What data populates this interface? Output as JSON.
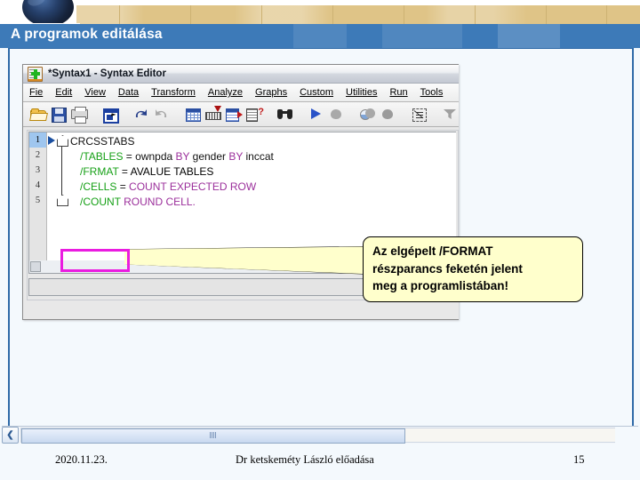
{
  "slide": {
    "title": "A programok editálása"
  },
  "spss_window": {
    "title": "*Syntax1 - Syntax Editor",
    "icon": "spss-document-icon",
    "menus": [
      {
        "label": "Fie",
        "accel": "F"
      },
      {
        "label": "Edit",
        "accel": "d"
      },
      {
        "label": "View",
        "accel": "V"
      },
      {
        "label": "Data",
        "accel": "D"
      },
      {
        "label": "Transform",
        "accel": "T"
      },
      {
        "label": "Analyze",
        "accel": "A"
      },
      {
        "label": "Graphs",
        "accel": "G"
      },
      {
        "label": "Custom",
        "accel": "C"
      },
      {
        "label": "Utilities",
        "accel": "U"
      },
      {
        "label": "Run",
        "accel": "R"
      },
      {
        "label": "Tools",
        "accel": "s"
      }
    ],
    "toolbar": [
      {
        "name": "open-file-icon"
      },
      {
        "name": "save-file-icon"
      },
      {
        "name": "print-icon"
      },
      {
        "name": "recall-dialog-icon"
      },
      {
        "name": "undo-icon"
      },
      {
        "name": "redo-icon"
      },
      {
        "name": "goto-data-icon"
      },
      {
        "name": "goto-case-icon"
      },
      {
        "name": "variables-icon"
      },
      {
        "name": "find-variable-icon"
      },
      {
        "name": "find-icon"
      },
      {
        "name": "run-selection-icon"
      },
      {
        "name": "run-all-icon"
      },
      {
        "name": "run-to-end-icon"
      },
      {
        "name": "step-through-icon"
      },
      {
        "name": "syntax-help-icon"
      },
      {
        "name": "breakpoint-icon"
      },
      {
        "name": "bookmark-icon"
      },
      {
        "name": "add-command-icon"
      }
    ],
    "editor": {
      "gutter_lines": [
        "1",
        "2",
        "3",
        "4",
        "5"
      ],
      "selected_line": 1,
      "lines": [
        {
          "indent": false,
          "tokens": [
            {
              "text": "CRCSSTABS",
              "style": "plain"
            }
          ]
        },
        {
          "indent": true,
          "tokens": [
            {
              "text": "/TABLES",
              "style": "sub"
            },
            {
              "text": " = ",
              "style": "plain"
            },
            {
              "text": "ownpda",
              "style": "plain"
            },
            {
              "text": " BY",
              "style": "key"
            },
            {
              "text": " gender",
              "style": "plain"
            },
            {
              "text": " BY",
              "style": "key"
            },
            {
              "text": " inccat",
              "style": "plain"
            }
          ]
        },
        {
          "indent": true,
          "tokens": [
            {
              "text": "/FRMAT",
              "style": "sub"
            },
            {
              "text": " = ",
              "style": "plain"
            },
            {
              "text": "AVALUE TABLES",
              "style": "plain"
            }
          ]
        },
        {
          "indent": true,
          "tokens": [
            {
              "text": "/CELLS",
              "style": "sub"
            },
            {
              "text": " = ",
              "style": "plain"
            },
            {
              "text": "COUNT EXPECTED ROW",
              "style": "key"
            }
          ]
        },
        {
          "indent": true,
          "tokens": [
            {
              "text": "/COUNT",
              "style": "sub"
            },
            {
              "text": " ",
              "style": "plain"
            },
            {
              "text": "ROUND CELL.",
              "style": "key"
            }
          ]
        }
      ]
    }
  },
  "callout": {
    "line1": "Az elgépelt /FORMAT",
    "line2": "részparancs feketén jelent",
    "line3": "meg a programlistában!",
    "background_color": "#ffffcc",
    "border_color": "#000000"
  },
  "highlight_box": {
    "name": "frmat-error-highlight",
    "color": "#ea1ce0"
  },
  "scrollbar": {
    "left_arrow": "❮",
    "right_arrow": "❯"
  },
  "footer": {
    "date": "2020.11.23.",
    "center": "Dr ketskeméty László előadása",
    "page": "15"
  },
  "colors": {
    "banner_blue": "#3d7ab8",
    "banner_tan": "#dfc487",
    "subcommand_green": "#16a016",
    "keyword_purple": "#9b2f9b",
    "plain_black": "#101010",
    "slide_body": "#f4f9fd"
  }
}
